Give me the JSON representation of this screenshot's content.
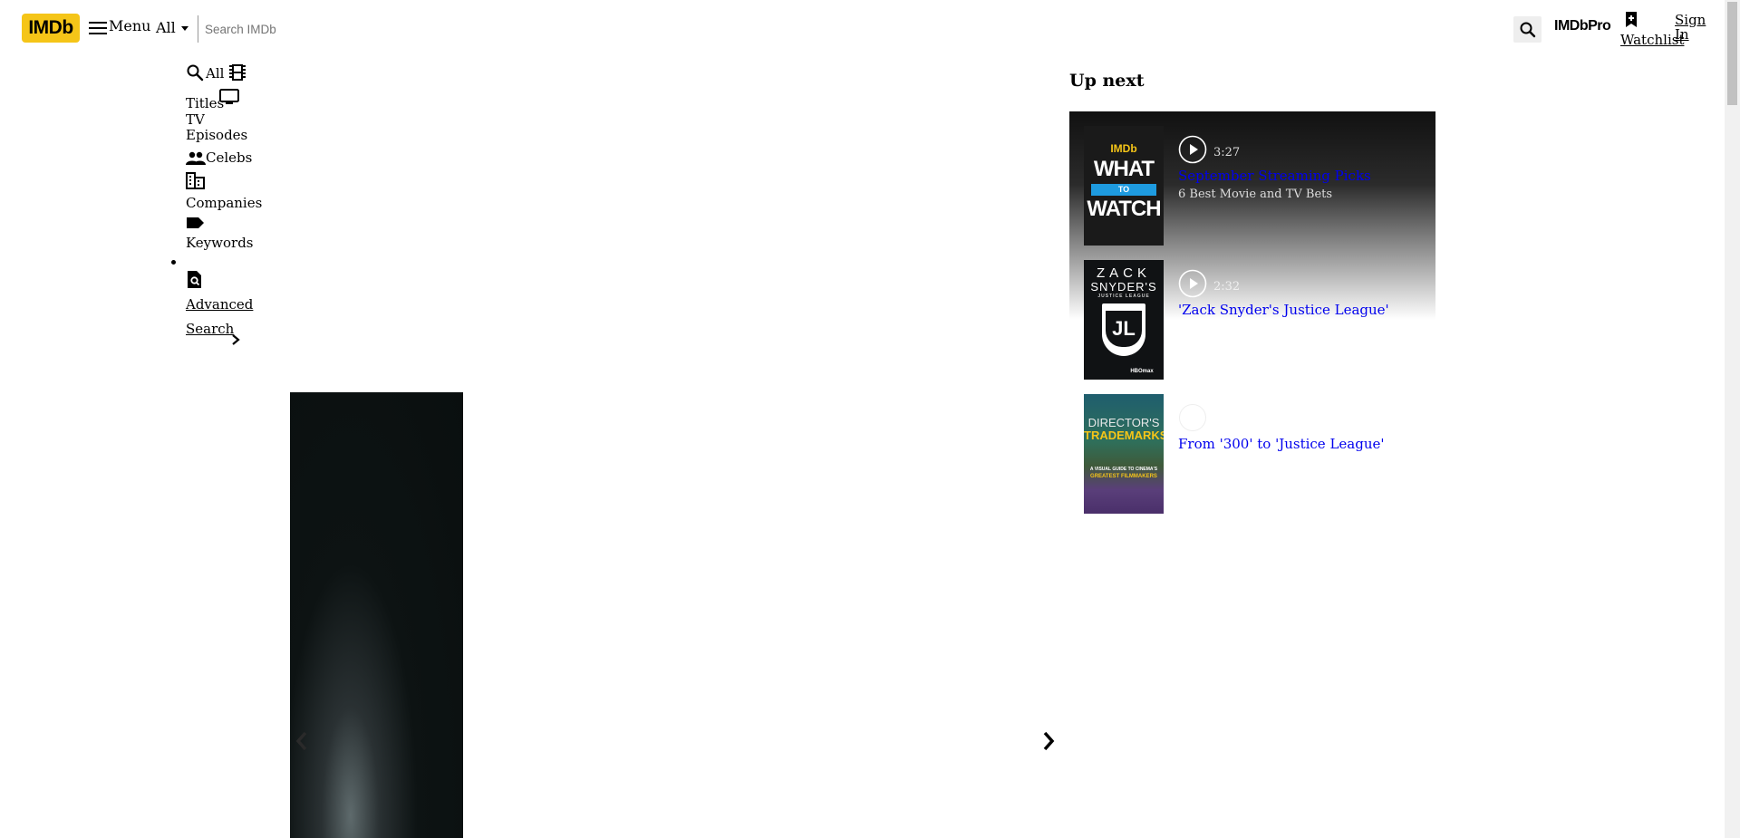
{
  "header": {
    "logo_text": "IMDb",
    "menu_label": "Menu",
    "search_category": "All",
    "search_placeholder": "Search IMDb",
    "imdbpro_label": "IMDbPro",
    "watchlist_label": "Watchlist",
    "signin_label": "Sign In"
  },
  "search_categories": {
    "all": "All",
    "titles": "Titles",
    "tv_episodes_1": "TV",
    "tv_episodes_2": "Episodes",
    "celebs": "Celebs",
    "companies": "Companies",
    "keywords": "Keywords",
    "advanced_1": "Advanced",
    "advanced_2": "Search"
  },
  "up_next": {
    "heading": "Up next",
    "items": [
      {
        "duration": "3:27",
        "title": "September Streaming Picks",
        "subtitle": "6 Best Movie and TV Bets",
        "poster": {
          "brand": "IMDb",
          "line1": "WHAT",
          "line2": "TO",
          "line3": "WATCH"
        }
      },
      {
        "duration": "2:32",
        "title": "'Zack Snyder's Justice League'",
        "subtitle": "",
        "poster": {
          "line1": "ZACK",
          "line2": "SNYDER'S",
          "line3": "JUSTICE LEAGUE",
          "emblem": "JL",
          "footer": "HBOmax"
        }
      },
      {
        "duration": "",
        "title": "From '300' to 'Justice League'",
        "subtitle": "",
        "poster": {
          "line1": "DIRECTOR'S",
          "line2": "TRADEMARKS",
          "line3": "A VISUAL GUIDE TO CINEMA'S",
          "line4": "GREATEST FILMMAKERS"
        }
      }
    ]
  },
  "colors": {
    "brand": "#f5c518",
    "link": "#0000ee"
  }
}
